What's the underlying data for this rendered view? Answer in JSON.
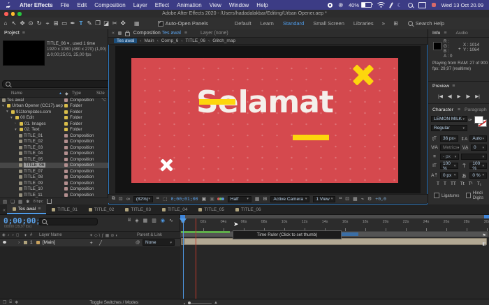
{
  "menubar": {
    "items": [
      "After Effects",
      "File",
      "Edit",
      "Composition",
      "Layer",
      "Effect",
      "Animation",
      "View",
      "Window",
      "Help"
    ],
    "battery": "40%",
    "clock": "Wed 13 Oct 20.09"
  },
  "titlebar": {
    "title": "Adobe After Effects 2020 - /Users/hadadalakbar/Editing/Urban Opener.aep *"
  },
  "toolbar": {
    "tools": [
      {
        "name": "home-tool",
        "glyph": "⌂"
      },
      {
        "name": "selection-tool",
        "glyph": "↖"
      },
      {
        "name": "hand-tool",
        "glyph": "✥"
      },
      {
        "name": "zoom-tool",
        "glyph": "⊙"
      },
      {
        "name": "orbit-camera-tool",
        "glyph": "↻"
      },
      {
        "name": "camera-tool",
        "glyph": "⌖"
      },
      {
        "name": "pan-behind-tool",
        "glyph": "⊞"
      },
      {
        "name": "shape-tool",
        "glyph": "▭"
      },
      {
        "name": "pen-tool",
        "glyph": "✒"
      },
      {
        "name": "type-tool",
        "glyph": "T"
      },
      {
        "name": "brush-tool",
        "glyph": "✎"
      },
      {
        "name": "clone-stamp-tool",
        "glyph": "❐"
      },
      {
        "name": "eraser-tool",
        "glyph": "◪"
      },
      {
        "name": "roto-brush-tool",
        "glyph": "✂"
      },
      {
        "name": "puppet-tool",
        "glyph": "✜"
      }
    ],
    "active_tool": "type-tool",
    "auto_open_panels": "Auto-Open Panels",
    "workspaces": [
      "Default",
      "Learn",
      "Standard",
      "Small Screen",
      "Libraries"
    ],
    "active_workspace": "Standard",
    "overflow": "»",
    "search_help": "Search Help"
  },
  "project": {
    "tab": "Project",
    "selected_item": {
      "line1": "TITLE_06 ▾ , used 1 time",
      "line2": "1920 x 1080 (480 x 270) (1,00)",
      "line3": "Δ 0;00;25;01, 25,00 fps"
    },
    "columns": {
      "name": "Name",
      "type": "Type",
      "size": "Size"
    },
    "rows": [
      {
        "name": "Tes awal",
        "type": "Composition",
        "kind": "comp",
        "indent": 0,
        "twirl": "",
        "shared": true
      },
      {
        "name": "Urban Opener (CC17).aep",
        "type": "Folder",
        "kind": "folder",
        "indent": 0,
        "twirl": "open"
      },
      {
        "name": "911templates.com",
        "type": "Folder",
        "kind": "folder",
        "indent": 1,
        "twirl": "open"
      },
      {
        "name": "00 Edit",
        "type": "Folder",
        "kind": "folder",
        "indent": 2,
        "twirl": "open"
      },
      {
        "name": "01. Images",
        "type": "Folder",
        "kind": "folder",
        "indent": 3,
        "twirl": "closed"
      },
      {
        "name": "02. Text",
        "type": "Folder",
        "kind": "folder",
        "indent": 3,
        "twirl": "open"
      },
      {
        "name": "TITLE_01",
        "type": "Composition",
        "kind": "comp",
        "indent": 4
      },
      {
        "name": "TITLE_02",
        "type": "Composition",
        "kind": "comp",
        "indent": 4
      },
      {
        "name": "TITLE_03",
        "type": "Composition",
        "kind": "comp",
        "indent": 4
      },
      {
        "name": "TITLE_04",
        "type": "Composition",
        "kind": "comp",
        "indent": 4
      },
      {
        "name": "TITLE_05",
        "type": "Composition",
        "kind": "comp",
        "indent": 4
      },
      {
        "name": "TITLE_06",
        "type": "Composition",
        "kind": "comp",
        "indent": 4,
        "selected": true
      },
      {
        "name": "TITLE_07",
        "type": "Composition",
        "kind": "comp",
        "indent": 4
      },
      {
        "name": "TITLE_08",
        "type": "Composition",
        "kind": "comp",
        "indent": 4
      },
      {
        "name": "TITLE_09",
        "type": "Composition",
        "kind": "comp",
        "indent": 4
      },
      {
        "name": "TITLE_10",
        "type": "Composition",
        "kind": "comp",
        "indent": 4
      },
      {
        "name": "TITLE_11",
        "type": "Composition",
        "kind": "comp",
        "indent": 4
      }
    ],
    "footer": {
      "bpc": "8 bpc"
    }
  },
  "viewer": {
    "tab_prefix": "Composition",
    "tab_name": "Tes awal",
    "layer_tab": "Layer (none)",
    "breadcrumb": [
      "Tes awal",
      "Main",
      "Comp_6",
      "TITLE_06",
      "Glitch_map"
    ],
    "canvas": {
      "title": "Selamat",
      "bg_color": "#d5494e",
      "accent_color": "#fdd60d",
      "text_color": "#f4f0eb"
    },
    "toolbar": {
      "zoom": "(82%)",
      "timecode": "0;00;01;00",
      "resolution": "Half",
      "camera": "Active Camera",
      "views": "1 View",
      "exposure": "+0,0"
    }
  },
  "info": {
    "tab": "Info",
    "tab2": "Audio",
    "r": "R :",
    "g": "G :",
    "b": "B :",
    "a": "A :  0",
    "x": "X : 1014",
    "y": "Y : 1064",
    "ram": "Playing from RAM: 27 of 900",
    "fps": "fps: 29,97 (realtime)"
  },
  "preview": {
    "tab": "Preview",
    "buttons": [
      {
        "name": "first-frame-button",
        "glyph": "|◀"
      },
      {
        "name": "previous-frame-button",
        "glyph": "◀|"
      },
      {
        "name": "play-button",
        "glyph": "▶"
      },
      {
        "name": "next-frame-button",
        "glyph": "|▶"
      },
      {
        "name": "last-frame-button",
        "glyph": "▶|"
      }
    ]
  },
  "character": {
    "tab": "Character",
    "tab2": "Paragraph",
    "overflow": "»",
    "font": "LEMON MILK",
    "style": "Regular",
    "size": "36 px",
    "leading": "Auto",
    "kerning": "Metrics",
    "tracking": "0",
    "baseline_unit": "- px",
    "vscale": "100 %",
    "hscale": "100 %",
    "baseline_shift": "0 px",
    "tsume": "0 %",
    "faux": [
      {
        "name": "faux-bold-button",
        "glyph": "T"
      },
      {
        "name": "faux-italic-button",
        "glyph": "T"
      },
      {
        "name": "all-caps-button",
        "glyph": "TT"
      },
      {
        "name": "small-caps-button",
        "glyph": "Tt"
      },
      {
        "name": "superscript-button",
        "glyph": "T¹"
      },
      {
        "name": "subscript-button",
        "glyph": "T₁"
      }
    ],
    "ligatures": "Ligatures",
    "hindi_digits": "Hindi Digits"
  },
  "timeline": {
    "tabs": [
      "Tes awal",
      "TITLE_01",
      "TITLE_02",
      "TITLE_03",
      "TITLE_04",
      "TITLE_05",
      "TITLE_06"
    ],
    "active_tab": "Tes awal",
    "timecode": "0;00;00;00",
    "timecode_sub": "00000 (29,97 fps)",
    "columns": {
      "layer_name": "Layer Name",
      "parent": "Parent & Link"
    },
    "layer": {
      "num": "1",
      "name": "[Main]",
      "parent": "None"
    },
    "ruler_ticks": [
      "0s",
      "02s",
      "04s",
      "06s",
      "08s",
      "10s",
      "12s",
      "14s",
      "16s",
      "18s",
      "20s",
      "22s",
      "24s",
      "26s",
      "28s",
      "30s"
    ],
    "tooltip": "Time Ruler (Click to set thumb)",
    "footer": "Toggle Switches / Modes"
  },
  "colors": {
    "accent_blue": "#4f9be8",
    "menubar": "#3c3c85",
    "canvas_red": "#d5494e",
    "canvas_yellow": "#fdd60d",
    "layerbar_tan": "#b2a893"
  }
}
